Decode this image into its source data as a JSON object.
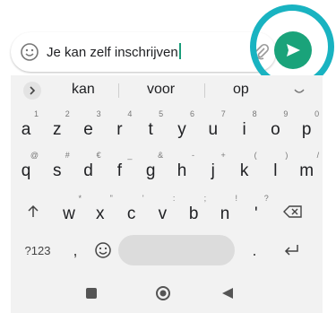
{
  "input": {
    "text": "Je kan zelf inschrijven"
  },
  "icons": {
    "emoji": "emoji-icon",
    "attach": "paperclip-icon",
    "send": "send-icon",
    "shift": "shift-arrow-icon",
    "backspace": "backspace-icon",
    "enter": "enter-icon"
  },
  "suggestions": [
    "kan",
    "voor",
    "op"
  ],
  "keyboard": {
    "row1": [
      {
        "k": "a",
        "h": "1"
      },
      {
        "k": "z",
        "h": "2"
      },
      {
        "k": "e",
        "h": "3"
      },
      {
        "k": "r",
        "h": "4"
      },
      {
        "k": "t",
        "h": "5"
      },
      {
        "k": "y",
        "h": "6"
      },
      {
        "k": "u",
        "h": "7"
      },
      {
        "k": "i",
        "h": "8"
      },
      {
        "k": "o",
        "h": "9"
      },
      {
        "k": "p",
        "h": "0"
      }
    ],
    "row2": [
      {
        "k": "q",
        "h": "@"
      },
      {
        "k": "s",
        "h": "#"
      },
      {
        "k": "d",
        "h": "€"
      },
      {
        "k": "f",
        "h": "_"
      },
      {
        "k": "g",
        "h": "&"
      },
      {
        "k": "h",
        "h": "-"
      },
      {
        "k": "j",
        "h": "+"
      },
      {
        "k": "k",
        "h": "("
      },
      {
        "k": "l",
        "h": ")"
      },
      {
        "k": "m",
        "h": "/"
      }
    ],
    "row3": [
      {
        "k": "w",
        "h": "*"
      },
      {
        "k": "x",
        "h": "\""
      },
      {
        "k": "c",
        "h": "'"
      },
      {
        "k": "v",
        "h": ":"
      },
      {
        "k": "b",
        "h": ";"
      },
      {
        "k": "n",
        "h": "!"
      },
      {
        "k": "'",
        "h": "?"
      }
    ],
    "symbols_label": "?123",
    "comma": ",",
    "period": "."
  },
  "colors": {
    "send_button": "#1aa37a",
    "highlight_ring": "#19b3c1",
    "keyboard_bg": "#f2f2f2"
  }
}
